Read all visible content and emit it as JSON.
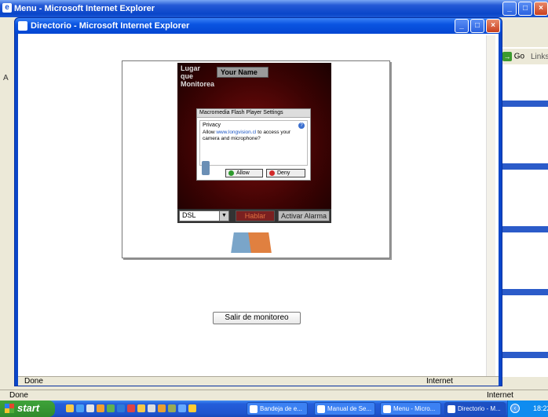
{
  "background_window": {
    "title": "Menu - Microsoft Internet Explorer",
    "go_label": "Go",
    "links_label": "Links",
    "address_letter": "A",
    "status_left": "Done",
    "status_right": "Internet"
  },
  "front_window": {
    "title": "Directorio - Microsoft Internet Explorer",
    "status_left": "Done",
    "status_right": "Internet"
  },
  "flash_app": {
    "lugar_label": "Lugar que Monitorea",
    "name_value": "Your Name",
    "connection_select": "DSL",
    "hablar_button": "Hablar",
    "alarma_button": "Activar Alarma"
  },
  "flash_settings": {
    "title": "Macromedia Flash Player Settings",
    "section": "Privacy",
    "text_before": "Allow ",
    "link": "www.longvision.cl",
    "text_after": " to access your camera and microphone?",
    "allow": "Allow",
    "deny": "Deny"
  },
  "page": {
    "salir_button": "Salir de monitoreo"
  },
  "taskbar": {
    "start_label": "start",
    "tasks": [
      {
        "label": "Bandeja de e..."
      },
      {
        "label": "Manual de Se..."
      },
      {
        "label": "Menu - Micro..."
      },
      {
        "label": "Directorio - M..."
      }
    ],
    "clock": "18:22"
  },
  "colors": {
    "xp_blue": "#0a46c9",
    "flash_red": "#7a0d0d",
    "start_green": "#3fa33a"
  }
}
